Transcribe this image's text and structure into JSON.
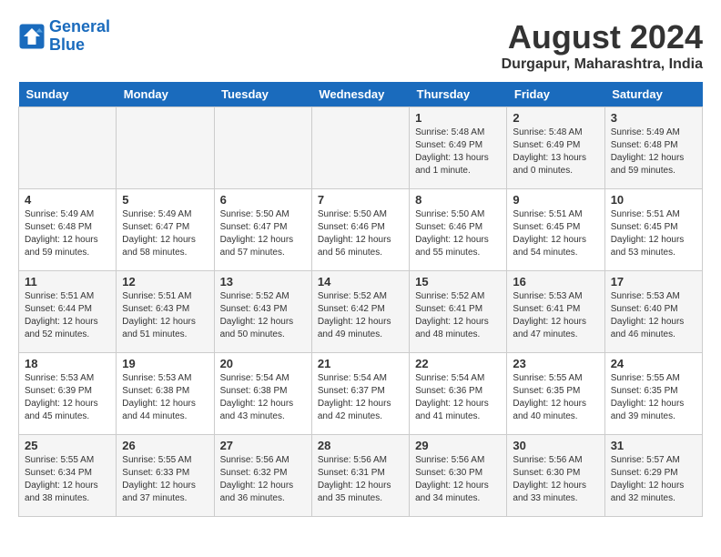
{
  "header": {
    "logo_line1": "General",
    "logo_line2": "Blue",
    "month_year": "August 2024",
    "location": "Durgapur, Maharashtra, India"
  },
  "days_of_week": [
    "Sunday",
    "Monday",
    "Tuesday",
    "Wednesday",
    "Thursday",
    "Friday",
    "Saturday"
  ],
  "weeks": [
    [
      {
        "num": "",
        "info": ""
      },
      {
        "num": "",
        "info": ""
      },
      {
        "num": "",
        "info": ""
      },
      {
        "num": "",
        "info": ""
      },
      {
        "num": "1",
        "info": "Sunrise: 5:48 AM\nSunset: 6:49 PM\nDaylight: 13 hours\nand 1 minute."
      },
      {
        "num": "2",
        "info": "Sunrise: 5:48 AM\nSunset: 6:49 PM\nDaylight: 13 hours\nand 0 minutes."
      },
      {
        "num": "3",
        "info": "Sunrise: 5:49 AM\nSunset: 6:48 PM\nDaylight: 12 hours\nand 59 minutes."
      }
    ],
    [
      {
        "num": "4",
        "info": "Sunrise: 5:49 AM\nSunset: 6:48 PM\nDaylight: 12 hours\nand 59 minutes."
      },
      {
        "num": "5",
        "info": "Sunrise: 5:49 AM\nSunset: 6:47 PM\nDaylight: 12 hours\nand 58 minutes."
      },
      {
        "num": "6",
        "info": "Sunrise: 5:50 AM\nSunset: 6:47 PM\nDaylight: 12 hours\nand 57 minutes."
      },
      {
        "num": "7",
        "info": "Sunrise: 5:50 AM\nSunset: 6:46 PM\nDaylight: 12 hours\nand 56 minutes."
      },
      {
        "num": "8",
        "info": "Sunrise: 5:50 AM\nSunset: 6:46 PM\nDaylight: 12 hours\nand 55 minutes."
      },
      {
        "num": "9",
        "info": "Sunrise: 5:51 AM\nSunset: 6:45 PM\nDaylight: 12 hours\nand 54 minutes."
      },
      {
        "num": "10",
        "info": "Sunrise: 5:51 AM\nSunset: 6:45 PM\nDaylight: 12 hours\nand 53 minutes."
      }
    ],
    [
      {
        "num": "11",
        "info": "Sunrise: 5:51 AM\nSunset: 6:44 PM\nDaylight: 12 hours\nand 52 minutes."
      },
      {
        "num": "12",
        "info": "Sunrise: 5:51 AM\nSunset: 6:43 PM\nDaylight: 12 hours\nand 51 minutes."
      },
      {
        "num": "13",
        "info": "Sunrise: 5:52 AM\nSunset: 6:43 PM\nDaylight: 12 hours\nand 50 minutes."
      },
      {
        "num": "14",
        "info": "Sunrise: 5:52 AM\nSunset: 6:42 PM\nDaylight: 12 hours\nand 49 minutes."
      },
      {
        "num": "15",
        "info": "Sunrise: 5:52 AM\nSunset: 6:41 PM\nDaylight: 12 hours\nand 48 minutes."
      },
      {
        "num": "16",
        "info": "Sunrise: 5:53 AM\nSunset: 6:41 PM\nDaylight: 12 hours\nand 47 minutes."
      },
      {
        "num": "17",
        "info": "Sunrise: 5:53 AM\nSunset: 6:40 PM\nDaylight: 12 hours\nand 46 minutes."
      }
    ],
    [
      {
        "num": "18",
        "info": "Sunrise: 5:53 AM\nSunset: 6:39 PM\nDaylight: 12 hours\nand 45 minutes."
      },
      {
        "num": "19",
        "info": "Sunrise: 5:53 AM\nSunset: 6:38 PM\nDaylight: 12 hours\nand 44 minutes."
      },
      {
        "num": "20",
        "info": "Sunrise: 5:54 AM\nSunset: 6:38 PM\nDaylight: 12 hours\nand 43 minutes."
      },
      {
        "num": "21",
        "info": "Sunrise: 5:54 AM\nSunset: 6:37 PM\nDaylight: 12 hours\nand 42 minutes."
      },
      {
        "num": "22",
        "info": "Sunrise: 5:54 AM\nSunset: 6:36 PM\nDaylight: 12 hours\nand 41 minutes."
      },
      {
        "num": "23",
        "info": "Sunrise: 5:55 AM\nSunset: 6:35 PM\nDaylight: 12 hours\nand 40 minutes."
      },
      {
        "num": "24",
        "info": "Sunrise: 5:55 AM\nSunset: 6:35 PM\nDaylight: 12 hours\nand 39 minutes."
      }
    ],
    [
      {
        "num": "25",
        "info": "Sunrise: 5:55 AM\nSunset: 6:34 PM\nDaylight: 12 hours\nand 38 minutes."
      },
      {
        "num": "26",
        "info": "Sunrise: 5:55 AM\nSunset: 6:33 PM\nDaylight: 12 hours\nand 37 minutes."
      },
      {
        "num": "27",
        "info": "Sunrise: 5:56 AM\nSunset: 6:32 PM\nDaylight: 12 hours\nand 36 minutes."
      },
      {
        "num": "28",
        "info": "Sunrise: 5:56 AM\nSunset: 6:31 PM\nDaylight: 12 hours\nand 35 minutes."
      },
      {
        "num": "29",
        "info": "Sunrise: 5:56 AM\nSunset: 6:30 PM\nDaylight: 12 hours\nand 34 minutes."
      },
      {
        "num": "30",
        "info": "Sunrise: 5:56 AM\nSunset: 6:30 PM\nDaylight: 12 hours\nand 33 minutes."
      },
      {
        "num": "31",
        "info": "Sunrise: 5:57 AM\nSunset: 6:29 PM\nDaylight: 12 hours\nand 32 minutes."
      }
    ]
  ]
}
